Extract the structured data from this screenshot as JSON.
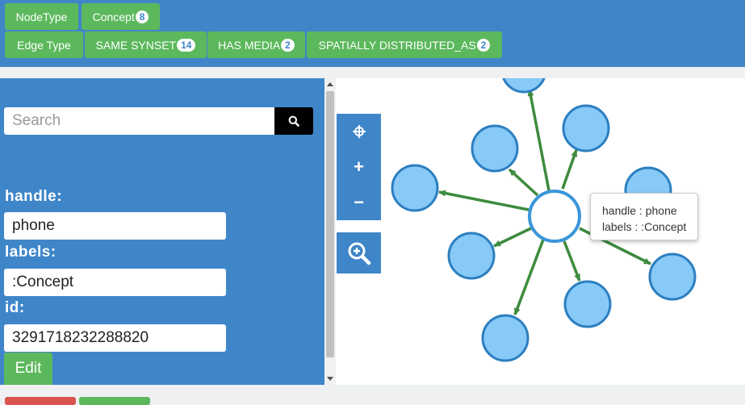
{
  "toolbar": {
    "node_type_label": "NodeType",
    "node_filters": [
      {
        "label": "Concept",
        "count": "8"
      }
    ],
    "edge_type_label": "Edge Type",
    "edge_filters": [
      {
        "label": "SAME SYNSET",
        "count": "14"
      },
      {
        "label": "HAS MEDIA",
        "count": "2"
      },
      {
        "label": "SPATIALLY DISTRIBUTED_AS",
        "count": "2"
      }
    ]
  },
  "sidebar": {
    "search_placeholder": "Search",
    "fields": [
      {
        "label": "handle:",
        "value": "phone"
      },
      {
        "label": "labels:",
        "value": ":Concept"
      },
      {
        "label": "id:",
        "value": "3291718232288820"
      }
    ],
    "edit_label": "Edit"
  },
  "graph_controls": {
    "icons": [
      "move-icon",
      "zoom-in-icon",
      "zoom-out-icon",
      "zoom-fit-icon"
    ],
    "plus_label": "+",
    "minus_label": "−"
  },
  "tooltip": {
    "line1": "handle : phone",
    "line2": "labels : :Concept"
  },
  "colors": {
    "primary_blue": "#3f86c9",
    "button_green": "#5cb85c",
    "node_fill": "#87c9f7",
    "node_stroke": "#2c7fc0",
    "edge_green": "#3d8b3d"
  }
}
